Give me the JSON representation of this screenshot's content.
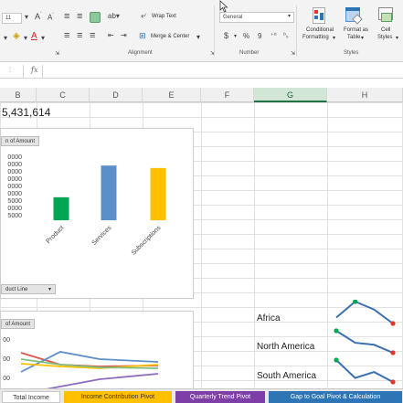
{
  "ribbon": {
    "font_size": "11",
    "wrap_text_label": "Wrap Text",
    "merge_center_label": "Merge & Center",
    "number_format": "General",
    "currency_symbol": "$",
    "percent_symbol": "%",
    "comma_symbol": "9",
    "conditional_formatting_label_1": "Conditional",
    "conditional_formatting_label_2": "Formatting",
    "format_as_table_label_1": "Format as",
    "format_as_table_label_2": "Table",
    "cell_styles_label_1": "Cell",
    "cell_styles_label_2": "Styles",
    "groups": {
      "alignment": "Alignment",
      "number": "Number",
      "styles": "Styles"
    }
  },
  "formula_bar": {
    "fx": "fx"
  },
  "columns": [
    "B",
    "C",
    "D",
    "E",
    "F",
    "G",
    "H"
  ],
  "selected_column": "G",
  "cell_b1": "5,431,614",
  "bar_chart": {
    "field_button": "n of Amount",
    "filter_button": "duct Line",
    "y_ticks": [
      "0000",
      "0000",
      "0000",
      "0000",
      "0000",
      "0000",
      "5000",
      "0000",
      "5000"
    ],
    "colors": [
      "#00a651",
      "#5b8fc9",
      "#ffc000"
    ]
  },
  "line_chart": {
    "field_button": "of Amount",
    "y_ticks": [
      "00",
      "00",
      "00"
    ],
    "colors": [
      "#d9584a",
      "#5b8fc9",
      "#ffc000",
      "#8e6bbf"
    ]
  },
  "chart_data": {
    "type": "bar",
    "categories": [
      "Product",
      "Services",
      "Subscriptions"
    ],
    "values": [
      1850000,
      4400000,
      4200000
    ],
    "ylim": [
      0,
      5000000
    ]
  },
  "regions": [
    "Africa",
    "North America",
    "South America"
  ],
  "sparklines": [
    {
      "values": [
        2,
        6,
        4,
        0.5
      ],
      "color": "#3a6fb0",
      "high_color": "#00a651",
      "low_color": "#e8322b"
    },
    {
      "values": [
        6,
        3,
        2.5,
        0.5
      ],
      "color": "#3a6fb0",
      "high_color": "#00a651",
      "low_color": "#e8322b"
    },
    {
      "values": [
        6,
        1.5,
        3,
        0.5
      ],
      "color": "#3a6fb0",
      "high_color": "#00a651",
      "low_color": "#e8322b"
    }
  ],
  "sheet_tabs": [
    {
      "label": "Total Income",
      "color": "#ffffff",
      "text_color": "#333333"
    },
    {
      "label": "Income Contribution Pivot",
      "color": "#ffc000",
      "text_color": "#333333"
    },
    {
      "label": "Quarterly Trend Pivot",
      "color": "#7d3ea8",
      "text_color": "#ffffff"
    },
    {
      "label": "Gap to Goal Pivot & Calculation",
      "color": "#2e75b6",
      "text_color": "#ffffff"
    }
  ]
}
